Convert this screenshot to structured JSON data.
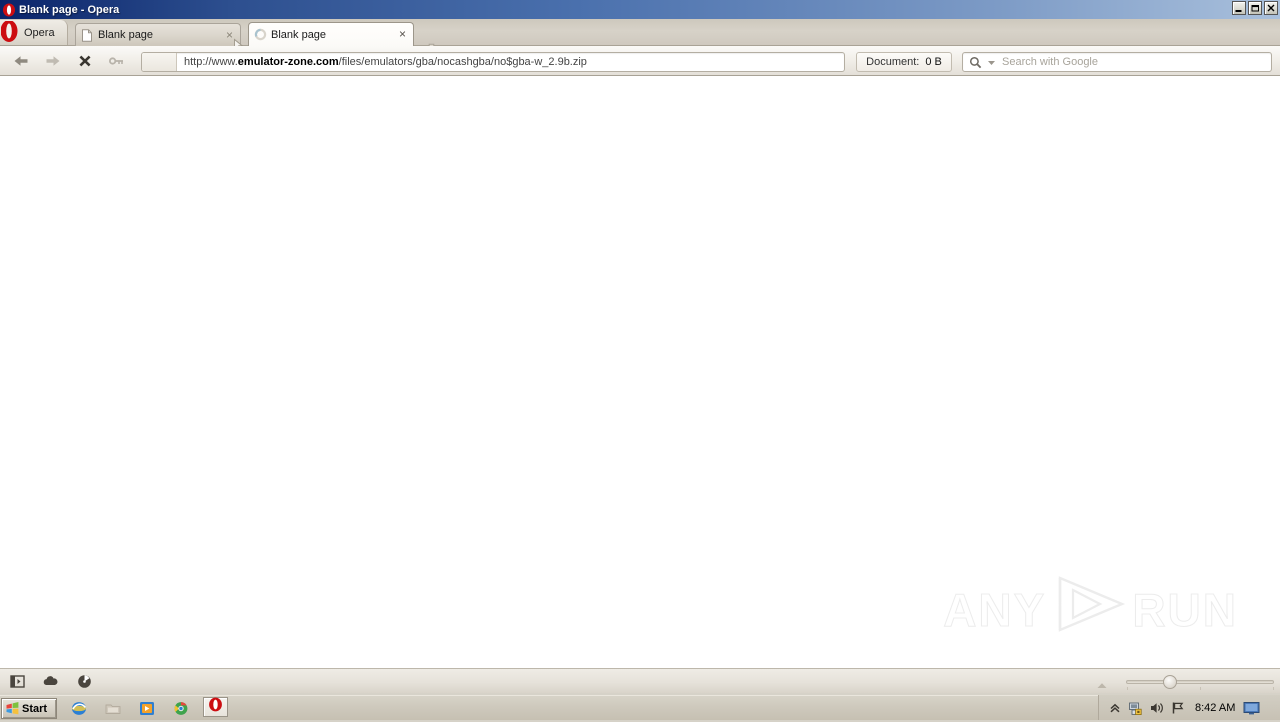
{
  "window": {
    "title": "Blank page - Opera",
    "logo_icon": "opera-logo-icon",
    "minimize_label": "_",
    "restore_label": "❐",
    "close_label": "×"
  },
  "tabstrip": {
    "menu_label": "Opera",
    "menu_icon": "opera-logo-icon",
    "new_tab_label": "+",
    "new_tab_icon": "plus-icon",
    "close_label": "×",
    "tabs": [
      {
        "label": "Blank page",
        "icon": "blank-document-icon",
        "active": false
      },
      {
        "label": "Blank page",
        "icon": "loading-spinner-icon",
        "active": true
      }
    ]
  },
  "toolbar": {
    "back_icon": "arrow-left-icon",
    "forward_icon": "arrow-right-icon",
    "stop_icon": "stop-x-icon",
    "wand_icon": "key-wand-icon",
    "address": {
      "url_full": "http://www.emulator-zone.com/files/emulators/gba/nocashgba/no$gba-w_2.9b.zip",
      "url_prefix": "http://www.",
      "url_domain": "emulator-zone.com",
      "url_path": "/files/emulators/gba/nocashgba/no$gba-w_2.9b.zip"
    },
    "document_info": {
      "label": "Document:",
      "value": "0 B"
    },
    "search": {
      "placeholder": "Search with Google",
      "icon": "search-icon",
      "dropdown_icon": "chevron-down-icon"
    }
  },
  "page": {
    "watermark_left": "ANY",
    "watermark_right": "RUN",
    "watermark_logo_icon": "play-triangle-icon"
  },
  "statusbar": {
    "panel_icon": "panel-toggle-icon",
    "link_icon": "cloud-icon",
    "turbo_icon": "speedometer-icon",
    "scroll_icon": "triangle-up-icon",
    "zoom_slider_value": 25
  },
  "taskbar": {
    "start_label": "Start",
    "start_icon": "windows-flag-icon",
    "quicklaunch": [
      {
        "name": "internet-explorer-icon"
      },
      {
        "name": "folder-icon"
      },
      {
        "name": "media-player-icon"
      },
      {
        "name": "chrome-icon"
      }
    ],
    "task_buttons": [
      {
        "name": "opera-taskbar-button",
        "icon": "opera-logo-icon"
      }
    ],
    "tray": {
      "expand_icon": "chevron-up-icon",
      "network_icon": "network-lock-icon",
      "volume_icon": "volume-icon",
      "flag_icon": "flag-icon",
      "clock": "8:42 AM",
      "display_icon": "monitor-icon"
    }
  },
  "colors": {
    "titlebar_dark": "#0a246a",
    "titlebar_light": "#a9c0dc",
    "chrome_bg": "#d6d2c8",
    "opera_red": "#cc0d11",
    "page_bg": "#ffffff",
    "watermark": "#ececec"
  }
}
